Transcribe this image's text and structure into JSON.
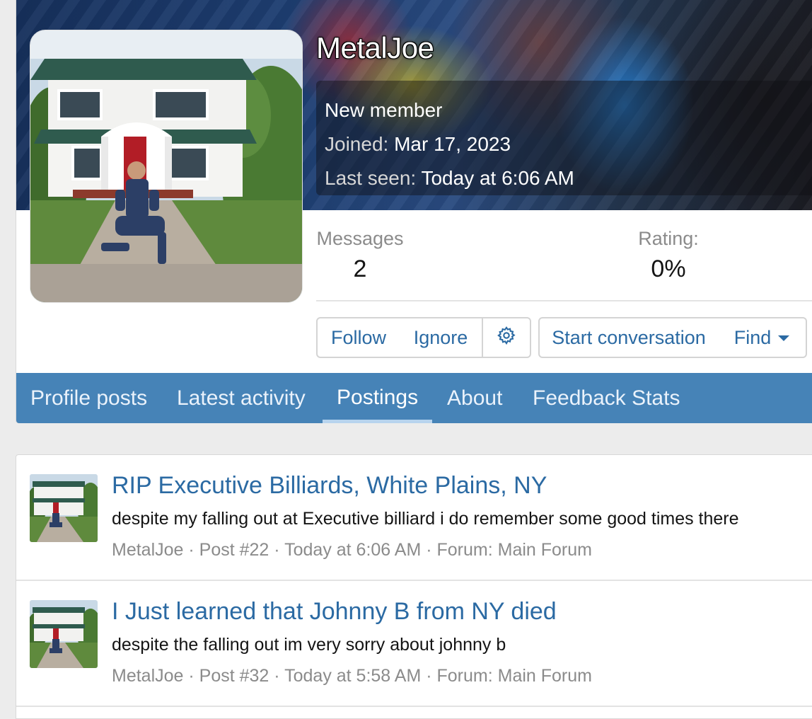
{
  "profile": {
    "username": "MetalJoe",
    "user_title": "New member",
    "joined_label": "Joined:",
    "joined_value": "Mar 17, 2023",
    "last_seen_label": "Last seen:",
    "last_seen_value": "Today at 6:06 AM"
  },
  "stats": {
    "messages_label": "Messages",
    "messages_value": "2",
    "rating_label": "Rating:",
    "rating_value": "0%"
  },
  "actions": {
    "follow": "Follow",
    "ignore": "Ignore",
    "settings_icon": "gear-icon",
    "start_conversation": "Start conversation",
    "find": "Find"
  },
  "tabs": [
    {
      "label": "Profile posts",
      "active": false
    },
    {
      "label": "Latest activity",
      "active": false
    },
    {
      "label": "Postings",
      "active": true
    },
    {
      "label": "About",
      "active": false
    },
    {
      "label": "Feedback Stats",
      "active": false
    }
  ],
  "posts": [
    {
      "title": "RIP Executive Billiards, White Plains, NY",
      "snippet": "despite my falling out at Executive billiard i do remember some good times there",
      "meta": "MetalJoe · Post #22 · Today at 6:06 AM · Forum: Main Forum"
    },
    {
      "title": "I Just learned that Johnny B from NY died",
      "snippet": "despite the falling out im very sorry about johnny b",
      "meta": "MetalJoe · Post #32 · Today at 5:58 AM · Forum: Main Forum"
    }
  ],
  "colors": {
    "link": "#2b6aa3",
    "tab_bar": "#4683b7",
    "muted": "#8b8b8b"
  }
}
